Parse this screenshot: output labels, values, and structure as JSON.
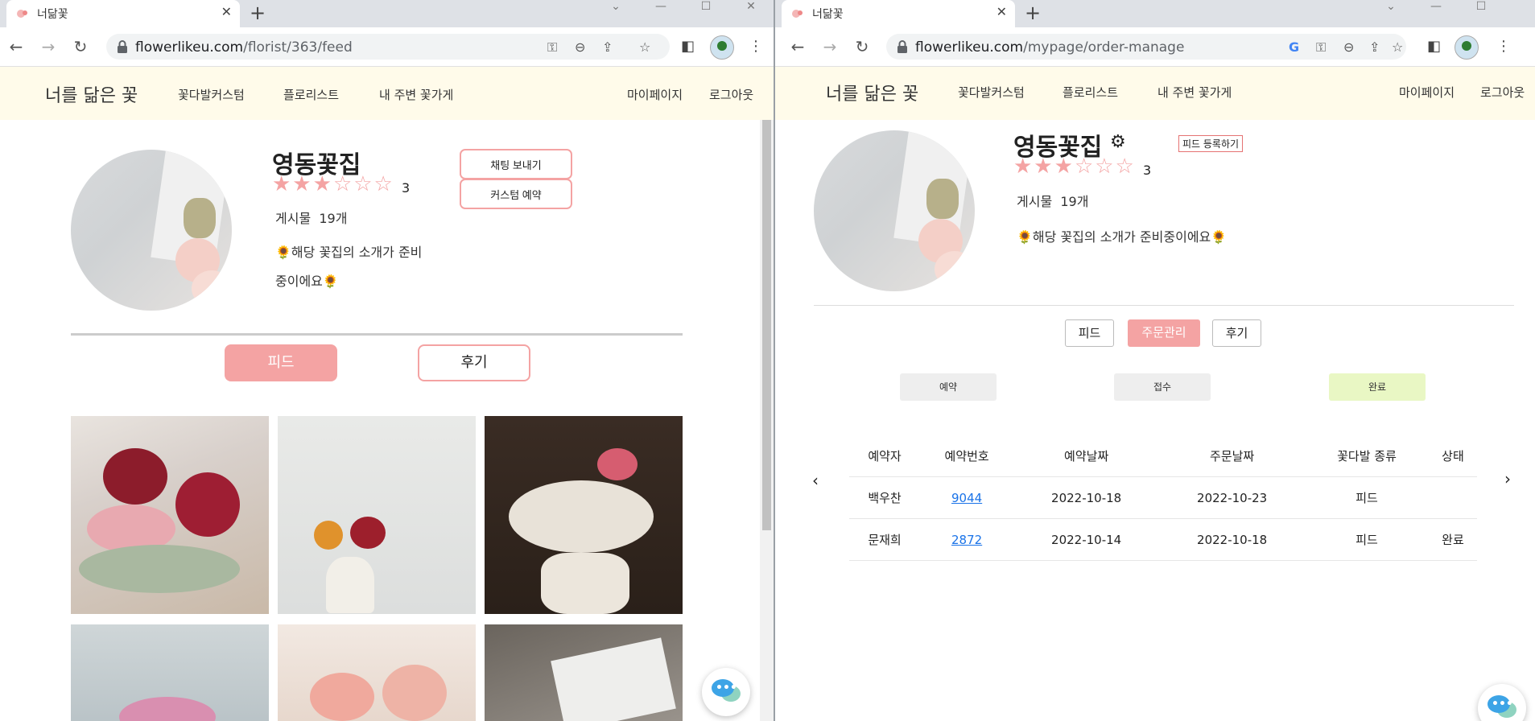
{
  "left": {
    "tab_title": "너닮꽃",
    "url_host": "flowerlikeu.com",
    "url_path": "/florist/363/feed",
    "brand": "너를 닮은 꽃",
    "nav": [
      "꽃다발커스텀",
      "플로리스트",
      "내 주변 꽃가게"
    ],
    "nav_right": [
      "마이페이지",
      "로그아웃"
    ],
    "shop_name": "영동꽃집",
    "stars_filled": "★★★",
    "stars_empty": "☆☆☆",
    "rating": "3",
    "posts_label": "게시물",
    "posts_count": "19개",
    "intro_line1": "🌻해당 꽃집의 소개가 준비",
    "intro_line2": "중이에요🌻",
    "chat_button": "채팅 보내기",
    "custom_button": "커스텀 예약",
    "tabs": [
      "피드",
      "후기"
    ]
  },
  "right": {
    "tab_title": "너닮꽃",
    "url_host": "flowerlikeu.com",
    "url_path": "/mypage/order-manage",
    "brand": "너를 닮은 꽃",
    "nav": [
      "꽃다발커스텀",
      "플로리스트",
      "내 주변 꽃가게"
    ],
    "nav_right": [
      "마이페이지",
      "로그아웃"
    ],
    "shop_name": "영동꽃집",
    "feed_register": "피드 등록하기",
    "stars_filled": "★★★",
    "stars_empty": "☆☆☆",
    "rating": "3",
    "posts_label": "게시물",
    "posts_count": "19개",
    "intro": "🌻해당 꽃집의 소개가 준비중이에요🌻",
    "tabs": [
      "피드",
      "주문관리",
      "후기"
    ],
    "status_filters": [
      "예약",
      "접수",
      "완료"
    ],
    "table": {
      "headers": [
        "예약자",
        "예약번호",
        "예약날짜",
        "주문날짜",
        "꽃다발 종류",
        "상태"
      ],
      "rows": [
        [
          "백우찬",
          "9044",
          "2022-10-18",
          "2022-10-23",
          "피드",
          ""
        ],
        [
          "문재희",
          "2872",
          "2022-10-14",
          "2022-10-18",
          "피드",
          "완료"
        ]
      ]
    },
    "prev_arrow": "‹",
    "next_arrow": "›"
  },
  "colors": {
    "accent": "#f4a3a3",
    "nav_bg": "#fffbea",
    "done_bg": "#e9f7c4",
    "link": "#1a73e8"
  }
}
